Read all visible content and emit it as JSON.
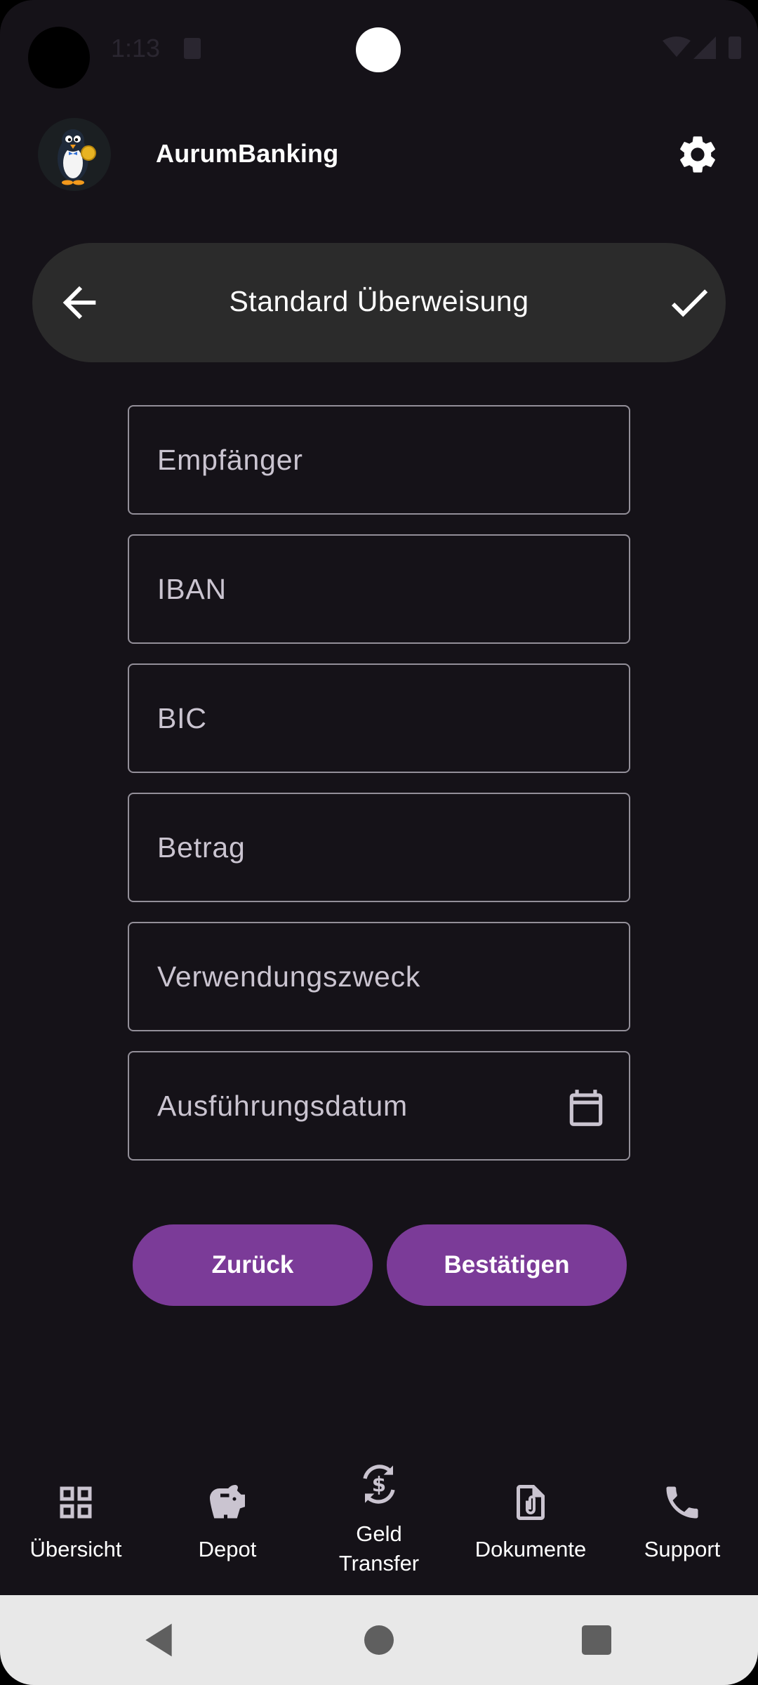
{
  "status_bar": {
    "time": "1:13"
  },
  "header": {
    "app_title": "AurumBanking",
    "logo_icon": "penguin-coin-logo",
    "settings_icon": "gear-icon"
  },
  "toolbar": {
    "title": "Standard Überweisung",
    "back_icon": "arrow-left-icon",
    "confirm_icon": "check-icon"
  },
  "form": {
    "recipient": {
      "placeholder": "Empfänger",
      "value": ""
    },
    "iban": {
      "placeholder": "IBAN",
      "value": ""
    },
    "bic": {
      "placeholder": "BIC",
      "value": ""
    },
    "amount": {
      "placeholder": "Betrag",
      "value": ""
    },
    "purpose": {
      "placeholder": "Verwendungszweck",
      "value": ""
    },
    "execution_date": {
      "placeholder": "Ausführungsdatum",
      "value": "",
      "icon": "calendar-icon"
    }
  },
  "actions": {
    "back_label": "Zurück",
    "confirm_label": "Bestätigen"
  },
  "bottom_nav": {
    "items": [
      {
        "label": "Übersicht",
        "icon": "grid-icon"
      },
      {
        "label": "Depot",
        "icon": "piggy-bank-icon"
      },
      {
        "label_line1": "Geld",
        "label_line2": "Transfer",
        "icon": "money-transfer-icon"
      },
      {
        "label": "Dokumente",
        "icon": "paperclip-document-icon"
      },
      {
        "label": "Support",
        "icon": "phone-icon"
      }
    ]
  },
  "colors": {
    "background": "#151218",
    "toolbar": "#2b2b2b",
    "accent": "#7b3b98",
    "field_border": "#938f99"
  }
}
